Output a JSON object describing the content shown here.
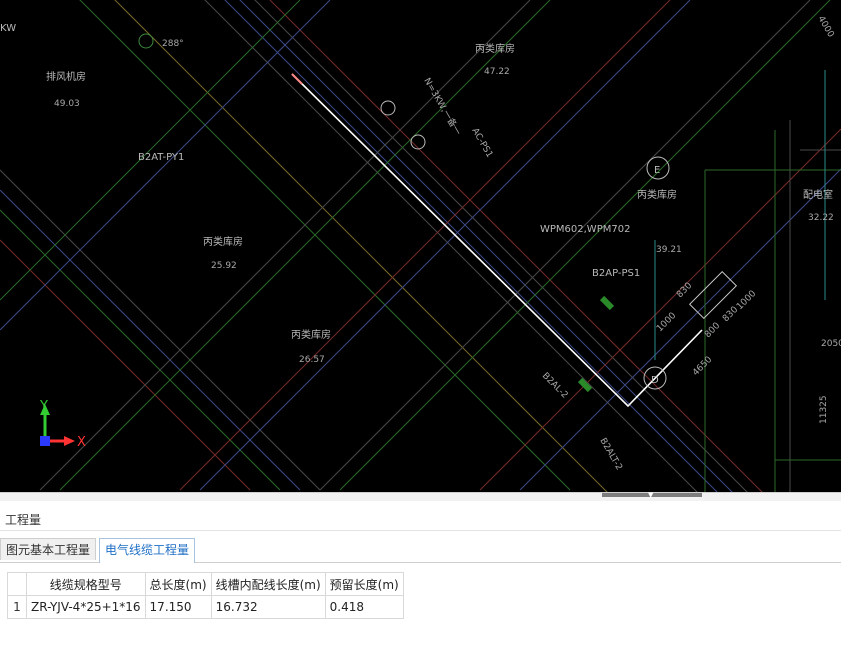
{
  "cad": {
    "labels": {
      "kw": "KW",
      "exhaust_room": "排风机房",
      "exhaust_area": "49.03",
      "deg": "288°",
      "b2at_py1": "B2AT-PY1",
      "storeroom": "丙类库房",
      "area_4722": "47.22",
      "storeroom_2": "丙类库房",
      "area_2592": "25.92",
      "storeroom_3": "丙类库房",
      "area_2657": "26.57",
      "storeroom_4": "丙类库房",
      "area_3921": "39.21",
      "dist_room": "配电室",
      "area_3222": "32.22",
      "wpm": "WPM602,WPM702",
      "b2ap_ps1": "B2AP-PS1",
      "b2al_2": "B2AL-2",
      "b2alt_2": "B2ALT-2",
      "ac_ps1": "AC-PS1",
      "n_kw": "N=3KW,一备一",
      "axis_e": "E",
      "axis_d": "D",
      "dim_4000": "4000",
      "dim_1000": "1000",
      "dim_2050": "2050",
      "dim_11325": "11325",
      "dim_830": "830",
      "dim_800": "800",
      "dim_4650": "4650",
      "dim_1000b": "1000",
      "dim_830b": "830"
    },
    "ucs": {
      "y_label": "Y",
      "x_label": "X"
    }
  },
  "panel": {
    "title": "工程量",
    "tabs": [
      {
        "label": "图元基本工程量",
        "active": false
      },
      {
        "label": "电气线缆工程量",
        "active": true
      }
    ],
    "table": {
      "headers": [
        "线缆规格型号",
        "总长度(m)",
        "线槽内配线长度(m)",
        "预留长度(m)"
      ],
      "rows": [
        {
          "index": "1",
          "cells": [
            "ZR-YJV-4*25+1*16",
            "17.150",
            "16.732",
            "0.418"
          ]
        }
      ]
    }
  },
  "colors": {
    "accent": "#1f6fc5",
    "cad_bg": "#000000",
    "cable": "#ffffff"
  }
}
